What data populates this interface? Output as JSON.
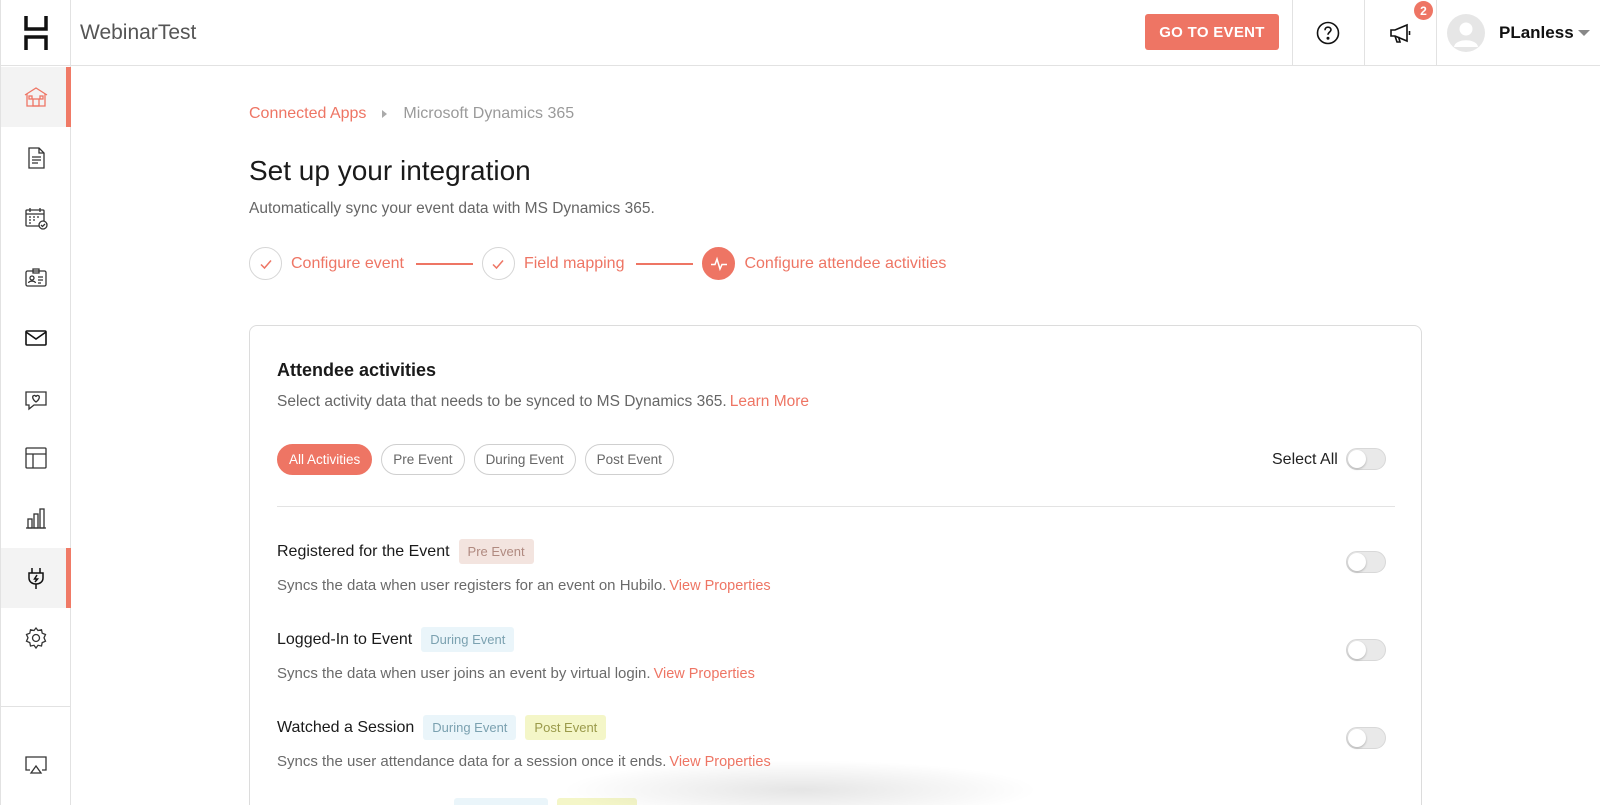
{
  "header": {
    "app_title": "WebinarTest",
    "go_to_event_label": "GO TO EVENT",
    "notification_count": "2",
    "user_name": "PLanless"
  },
  "sidebar": {
    "items": [
      {
        "icon": "home-icon",
        "active": true
      },
      {
        "icon": "document-icon",
        "active": false
      },
      {
        "icon": "calendar-check-icon",
        "active": false
      },
      {
        "icon": "id-card-icon",
        "active": false
      },
      {
        "icon": "mail-icon",
        "active": false
      },
      {
        "icon": "chat-heart-icon",
        "active": false
      },
      {
        "icon": "layout-icon",
        "active": false
      },
      {
        "icon": "bar-chart-icon",
        "active": false
      },
      {
        "icon": "plug-icon",
        "active": true
      },
      {
        "icon": "gear-icon",
        "active": false
      },
      {
        "icon": "cast-icon",
        "active": false
      }
    ]
  },
  "breadcrumb": {
    "link": "Connected Apps",
    "current": "Microsoft Dynamics 365"
  },
  "page": {
    "title": "Set up your integration",
    "subtitle": "Automatically sync your event data with MS Dynamics 365."
  },
  "stepper": {
    "steps": [
      {
        "label": "Configure event",
        "status": "done"
      },
      {
        "label": "Field mapping",
        "status": "done"
      },
      {
        "label": "Configure attendee activities",
        "status": "active"
      }
    ]
  },
  "card": {
    "title": "Attendee activities",
    "description": "Select activity data that needs to be synced to MS Dynamics 365.",
    "learn_more": "Learn More",
    "filters": [
      "All Activities",
      "Pre Event",
      "During Event",
      "Post Event"
    ],
    "active_filter": "All Activities",
    "select_all_label": "Select All",
    "activities": [
      {
        "title": "Registered for the Event",
        "tags": [
          "Pre Event"
        ],
        "description": "Syncs the data when user registers for an event on Hubilo.",
        "link": "View Properties",
        "enabled": false
      },
      {
        "title": "Logged-In to Event",
        "tags": [
          "During Event"
        ],
        "description": "Syncs the data when user joins an event by virtual login.",
        "link": "View Properties",
        "enabled": false
      },
      {
        "title": "Watched a Session",
        "tags": [
          "During Event",
          "Post Event"
        ],
        "description": "Syncs the user attendance data for a session once it ends.",
        "link": "View Properties",
        "enabled": false
      }
    ]
  },
  "colors": {
    "accent": "#ee7564",
    "pre_tag_bg": "#f3e4df",
    "during_tag_bg": "#eaf5fa",
    "post_tag_bg": "#f4f6c8"
  }
}
